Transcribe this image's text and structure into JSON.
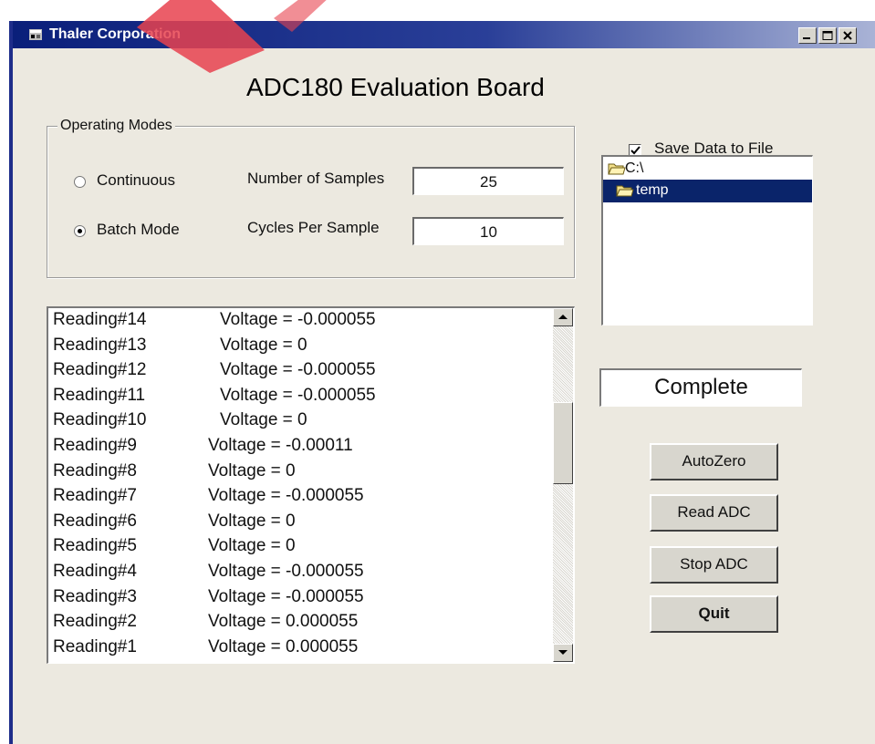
{
  "window": {
    "title": "Thaler Corporation",
    "minimize_label": "_",
    "maximize_label": "□",
    "close_label": "×"
  },
  "heading": "ADC180 Evaluation Board",
  "operating_modes": {
    "legend": "Operating Modes",
    "continuous_label": "Continuous",
    "batch_label": "Batch Mode",
    "selected": "Batch Mode",
    "num_samples_label": "Number of Samples",
    "num_samples_value": "25",
    "cycles_label": "Cycles Per Sample",
    "cycles_value": "10"
  },
  "readings": [
    {
      "reading": "Reading#14",
      "voltage": "Voltage = -0.000055"
    },
    {
      "reading": "Reading#13",
      "voltage": "Voltage = 0"
    },
    {
      "reading": "Reading#12",
      "voltage": "Voltage = -0.000055"
    },
    {
      "reading": "Reading#11",
      "voltage": "Voltage = -0.000055"
    },
    {
      "reading": "Reading#10",
      "voltage": "Voltage = 0"
    },
    {
      "reading": "Reading#9",
      "voltage": "Voltage = -0.00011"
    },
    {
      "reading": "Reading#8",
      "voltage": "Voltage = 0"
    },
    {
      "reading": "Reading#7",
      "voltage": "Voltage = -0.000055"
    },
    {
      "reading": "Reading#6",
      "voltage": "Voltage = 0"
    },
    {
      "reading": "Reading#5",
      "voltage": "Voltage = 0"
    },
    {
      "reading": "Reading#4",
      "voltage": "Voltage = -0.000055"
    },
    {
      "reading": "Reading#3",
      "voltage": "Voltage = -0.000055"
    },
    {
      "reading": "Reading#2",
      "voltage": "Voltage = 0.000055"
    },
    {
      "reading": "Reading#1",
      "voltage": "Voltage = 0.000055"
    }
  ],
  "save": {
    "label": "Save Data to File",
    "checked": true
  },
  "directories": {
    "items": [
      "C:\\",
      "temp"
    ],
    "selected": "temp"
  },
  "status": "Complete",
  "buttons": {
    "autozero": "AutoZero",
    "read_adc": "Read ADC",
    "stop_adc": "Stop ADC",
    "quit": "Quit"
  },
  "colors": {
    "titlebar": "#0a1f7a",
    "selection": "#0a246a",
    "face": "#ece9e0",
    "watermark": "#e8424f"
  }
}
